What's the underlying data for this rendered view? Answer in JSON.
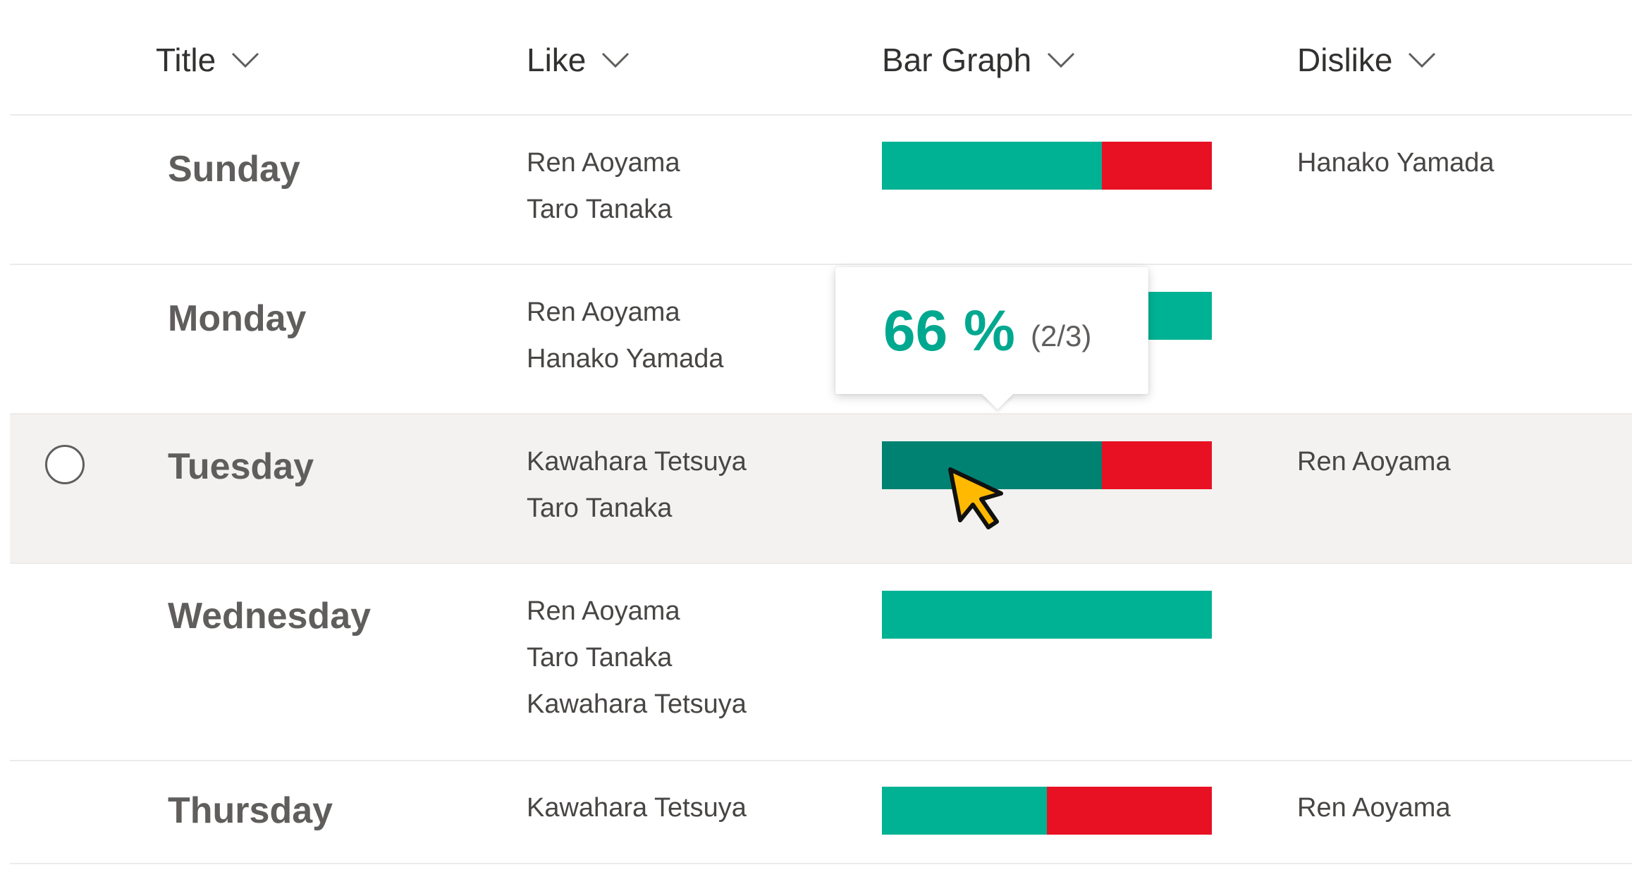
{
  "columns": {
    "title": "Title",
    "like": "Like",
    "bar_graph": "Bar Graph",
    "dislike": "Dislike"
  },
  "icons": {
    "sort": "chevron-down-icon",
    "cursor": "mouse-pointer-icon",
    "select": "radio-circle-icon"
  },
  "colors": {
    "like": "#00b294",
    "like_hover": "#008272",
    "dislike": "#e81123",
    "tooltip_percent": "#00a88f"
  },
  "rows": [
    {
      "title": "Sunday",
      "likes": [
        "Ren Aoyama",
        "Taro Tanaka"
      ],
      "dislikes": [
        "Hanako Yamada"
      ],
      "like_fraction": 0.6667
    },
    {
      "title": "Monday",
      "likes": [
        "Ren Aoyama",
        "Hanako Yamada"
      ],
      "dislikes": [],
      "like_fraction": 1.0
    },
    {
      "title": "Tuesday",
      "likes": [
        "Kawahara Tetsuya",
        "Taro Tanaka"
      ],
      "dislikes": [
        "Ren Aoyama"
      ],
      "like_fraction": 0.6667,
      "selected": true
    },
    {
      "title": "Wednesday",
      "likes": [
        "Ren Aoyama",
        "Taro Tanaka",
        "Kawahara Tetsuya"
      ],
      "dislikes": [],
      "like_fraction": 1.0
    },
    {
      "title": "Thursday",
      "likes": [
        "Kawahara Tetsuya"
      ],
      "dislikes": [
        "Ren Aoyama"
      ],
      "like_fraction": 0.5
    }
  ],
  "tooltip": {
    "percent": "66 %",
    "fraction": "(2/3)"
  }
}
